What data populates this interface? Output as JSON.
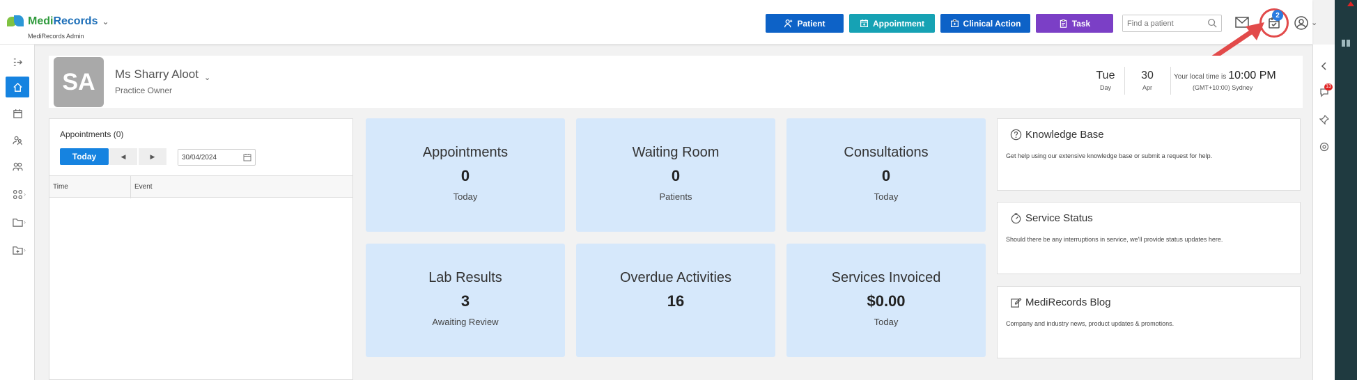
{
  "header": {
    "logo_part1": "Medi",
    "logo_part2": "Records",
    "logo_sub": "MediRecords Admin",
    "buttons": {
      "patient": "Patient",
      "appointment": "Appointment",
      "clinical_action": "Clinical Action",
      "task": "Task"
    },
    "search_placeholder": "Find a patient",
    "tasks_badge": "2"
  },
  "profile": {
    "initials": "SA",
    "name": "Ms Sharry Aloot",
    "role": "Practice Owner",
    "day_short": "Tue",
    "day_label": "Day",
    "date_num": "30",
    "month_label": "Apr",
    "local_time_label": "Your local time is",
    "local_time": "10:00 PM",
    "timezone": "(GMT+10:00) Sydney"
  },
  "appointments_panel": {
    "title": "Appointments (0)",
    "today_button": "Today",
    "prev_glyph": "◀",
    "next_glyph": "▶",
    "date_value": "30/04/2024",
    "col_time": "Time",
    "col_event": "Event"
  },
  "cards": [
    {
      "title": "Appointments",
      "value": "0",
      "sub": "Today"
    },
    {
      "title": "Waiting Room",
      "value": "0",
      "sub": "Patients"
    },
    {
      "title": "Consultations",
      "value": "0",
      "sub": "Today"
    },
    {
      "title": "Lab Results",
      "value": "3",
      "sub": "Awaiting Review"
    },
    {
      "title": "Overdue Activities",
      "value": "16",
      "sub": ""
    },
    {
      "title": "Services Invoiced",
      "value": "$0.00",
      "sub": "Today"
    }
  ],
  "info_panels": [
    {
      "title": "Knowledge Base",
      "desc": "Get help using our extensive knowledge base or submit a request for help.",
      "icon": "help-circle-icon"
    },
    {
      "title": "Service Status",
      "desc": "Should there be any interruptions in service, we'll provide status updates here.",
      "icon": "gauge-icon"
    },
    {
      "title": "MediRecords Blog",
      "desc": "Company and industry news, product updates & promotions.",
      "icon": "edit-icon"
    }
  ],
  "right_toolbar": {
    "notification_badge": "13"
  },
  "colors": {
    "primary": "#0d62c7",
    "teal": "#16a2b4",
    "purple": "#7b3fc6",
    "card_bg": "#d6e8fb",
    "highlight": "#e24a4a"
  }
}
